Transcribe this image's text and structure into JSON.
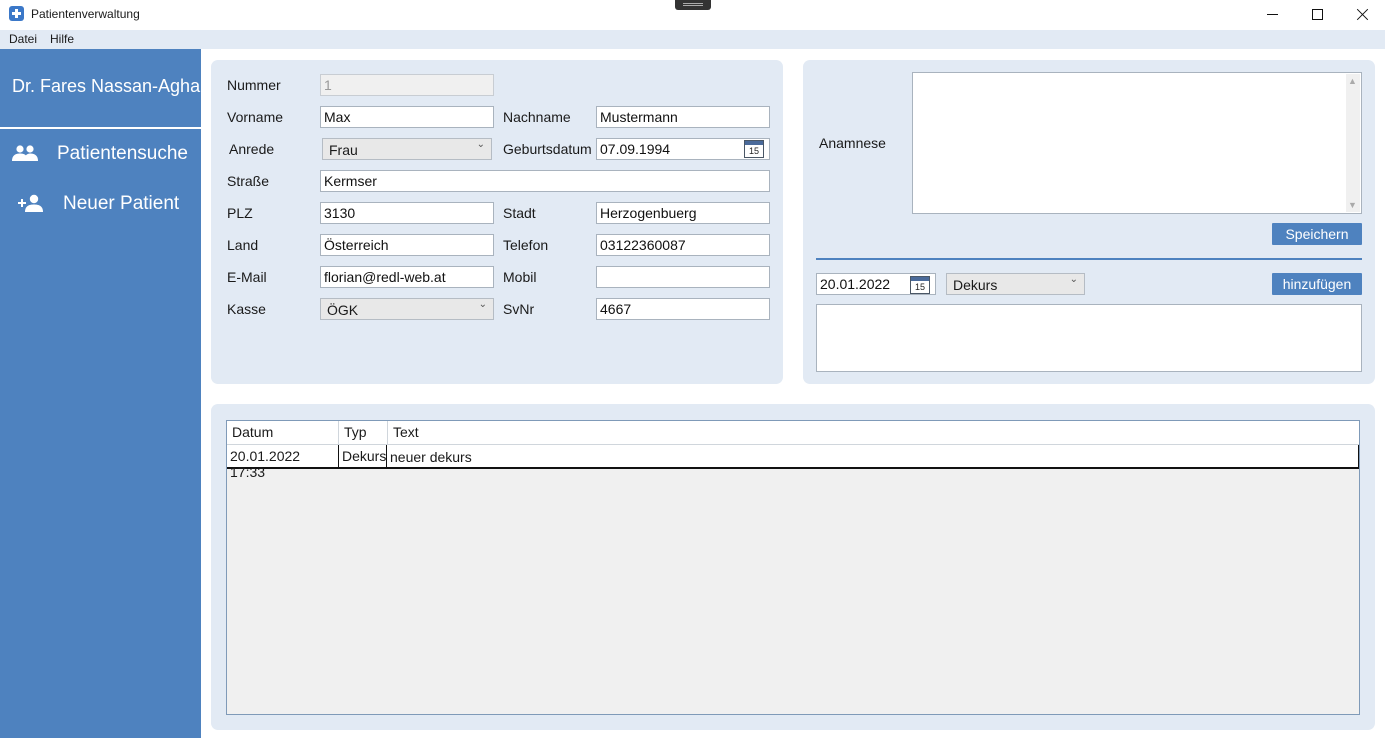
{
  "window": {
    "title": "Patientenverwaltung"
  },
  "menu": [
    "Datei",
    "Hilfe"
  ],
  "sidebar": {
    "doctor": "Dr. Fares Nassan-Agha",
    "items": [
      {
        "label": "Patientensuche",
        "icon": "people-icon"
      },
      {
        "label": "Neuer Patient",
        "icon": "add-person-icon"
      }
    ]
  },
  "form": {
    "nummer_label": "Nummer",
    "nummer": "1",
    "vorname_label": "Vorname",
    "vorname": "Max",
    "nachname_label": "Nachname",
    "nachname": "Mustermann",
    "anrede_label": "Anrede",
    "anrede": "Frau",
    "geburtsdatum_label": "Geburtsdatum",
    "geburtsdatum": "07.09.1994",
    "strasse_label": "Straße",
    "strasse": "Kermser",
    "plz_label": "PLZ",
    "plz": "3130",
    "stadt_label": "Stadt",
    "stadt": "Herzogenbuerg",
    "land_label": "Land",
    "land": "Österreich",
    "telefon_label": "Telefon",
    "telefon": "03122360087",
    "email_label": "E-Mail",
    "email": "florian@redl-web.at",
    "mobil_label": "Mobil",
    "mobil": "",
    "kasse_label": "Kasse",
    "kasse": "ÖGK",
    "svnr_label": "SvNr",
    "svnr": "4667"
  },
  "anamnese": {
    "label": "Anamnese",
    "text": "",
    "save_label": "Speichern"
  },
  "dekurs": {
    "date": "20.01.2022",
    "type": "Dekurs",
    "add_label": "hinzufügen",
    "text": ""
  },
  "calendar_day": "15",
  "table": {
    "columns": [
      "Datum",
      "Typ",
      "Text"
    ],
    "rows": [
      {
        "datum": "20.01.2022 17:33",
        "typ": "Dekurs",
        "text": "neuer dekurs"
      }
    ]
  },
  "colors": {
    "accent": "#4e82bf",
    "panel": "#e2eaf4"
  }
}
